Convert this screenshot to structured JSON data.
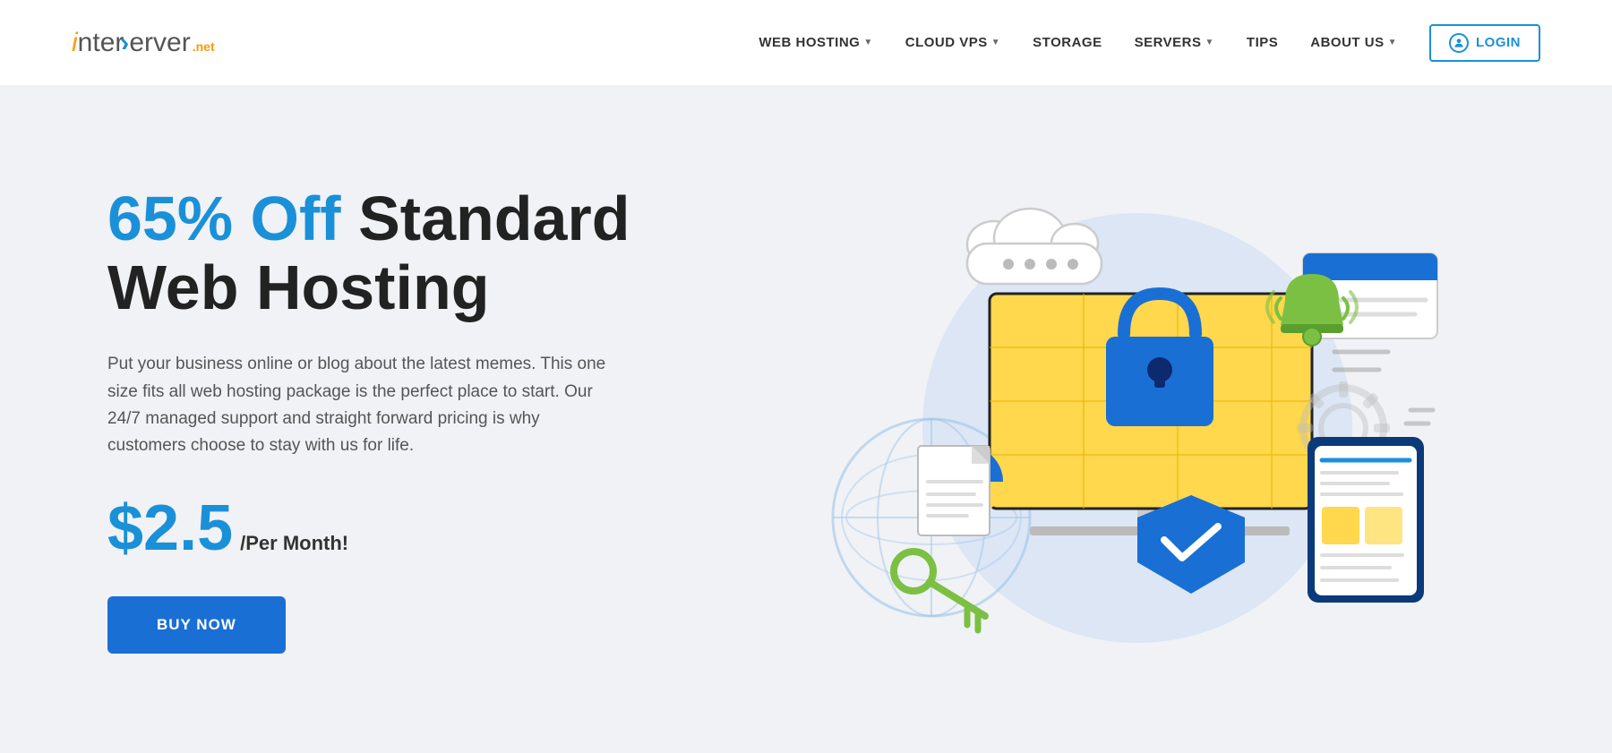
{
  "logo": {
    "part1": "inter",
    "i_letter": "i",
    "arrow": "S",
    "part2": "erver",
    "tld": ".net"
  },
  "nav": {
    "items": [
      {
        "id": "web-hosting",
        "label": "WEB HOSTING",
        "hasDropdown": true
      },
      {
        "id": "cloud-vps",
        "label": "CLOUD VPS",
        "hasDropdown": true
      },
      {
        "id": "storage",
        "label": "STORAGE",
        "hasDropdown": false
      },
      {
        "id": "servers",
        "label": "SERVERS",
        "hasDropdown": true
      },
      {
        "id": "tips",
        "label": "TIPS",
        "hasDropdown": false
      },
      {
        "id": "about-us",
        "label": "ABOUT US",
        "hasDropdown": true
      }
    ],
    "login_label": "LOGIN"
  },
  "hero": {
    "headline_blue": "65% Off",
    "headline_dark": "Standard\nWeb Hosting",
    "description": "Put your business online or blog about the latest memes. This one size fits all web hosting package is the perfect place to start. Our 24/7 managed support and straight forward pricing is why customers choose to stay with us for life.",
    "price_amount": "$2.5",
    "price_period": "/Per Month!",
    "cta_label": "BUY NOW"
  }
}
